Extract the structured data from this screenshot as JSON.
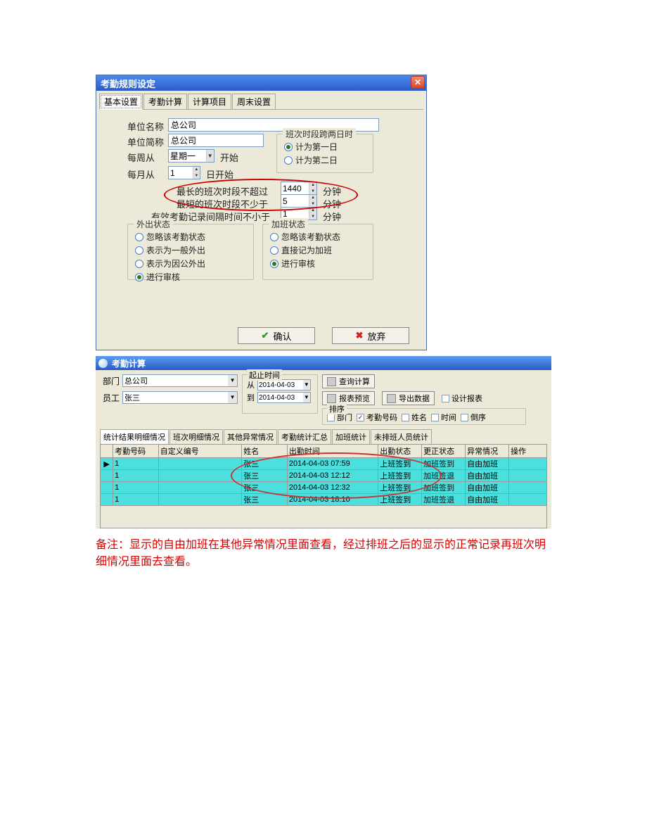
{
  "win1": {
    "title": "考勤规则设定",
    "tabs": [
      "基本设置",
      "考勤计算",
      "计算项目",
      "周末设置"
    ],
    "unit_name_label": "单位名称",
    "unit_name": "总公司",
    "unit_abbr_label": "单位简称",
    "unit_abbr": "总公司",
    "week_from_label": "每周从",
    "week_from_value": "星期一",
    "week_from_suffix": "开始",
    "month_from_label": "每月从",
    "month_from_value": "1",
    "month_from_suffix": "日开始",
    "span_group_title": "班次时段跨两日时",
    "span_opt1": "计为第一日",
    "span_opt2": "计为第二日",
    "max_shift_label": "最长的班次时段不超过",
    "max_shift_value": "1440",
    "min_shift_label": "最短的班次时段不少于",
    "min_shift_value": "5",
    "record_gap_label": "有效考勤记录间隔时间不小于",
    "record_gap_value": "1",
    "minute": "分钟",
    "out_group_title": "外出状态",
    "out_opts": [
      "忽略该考勤状态",
      "表示为一般外出",
      "表示为因公外出",
      "进行审核"
    ],
    "ot_group_title": "加班状态",
    "ot_opts": [
      "忽略该考勤状态",
      "直接记为加班",
      "进行审核"
    ],
    "btn_ok": "确认",
    "btn_cancel": "放弃"
  },
  "win2": {
    "title": "考勤计算",
    "dept_label": "部门",
    "dept_value": "总公司",
    "emp_label": "员工",
    "emp_value": "张三",
    "date_group": "起止时间",
    "date_from_label": "从",
    "date_from": "2014-04-03",
    "date_to_label": "到",
    "date_to": "2014-04-03",
    "btn_query": "查询计算",
    "btn_report": "报表预览",
    "btn_export": "导出数据",
    "chk_design": "设计报表",
    "sort_group": "排序",
    "sort_opts": [
      "部门",
      "考勤号码",
      "姓名",
      "时间",
      "倒序"
    ],
    "sort_checked": [
      false,
      true,
      false,
      false,
      false
    ],
    "tabs2": [
      "统计结果明细情况",
      "班次明细情况",
      "其他异常情况",
      "考勤统计汇总",
      "加班统计",
      "未排班人员统计"
    ],
    "columns": [
      "考勤号码",
      "自定义编号",
      "姓名",
      "出勤时间",
      "出勤状态",
      "更正状态",
      "异常情况",
      "操作"
    ],
    "rows": [
      {
        "num": "1",
        "custom": "",
        "name": "张三",
        "time": "2014-04-03 07:59",
        "status": "上班签到",
        "correct": "加班签到",
        "abnormal": "自由加班",
        "op": ""
      },
      {
        "num": "1",
        "custom": "",
        "name": "张三",
        "time": "2014-04-03 12:12",
        "status": "上班签到",
        "correct": "加班签退",
        "abnormal": "自由加班",
        "op": ""
      },
      {
        "num": "1",
        "custom": "",
        "name": "张三",
        "time": "2014-04-03 12:32",
        "status": "上班签到",
        "correct": "加班签到",
        "abnormal": "自由加班",
        "op": ""
      },
      {
        "num": "1",
        "custom": "",
        "name": "张三",
        "time": "2014-04-03 18:10",
        "status": "上班签到",
        "correct": "加班签退",
        "abnormal": "自由加班",
        "op": ""
      }
    ]
  },
  "note": "备注：显示的自由加班在其他异常情况里面查看，经过排班之后的显示的正常记录再班次明细情况里面去查看。"
}
